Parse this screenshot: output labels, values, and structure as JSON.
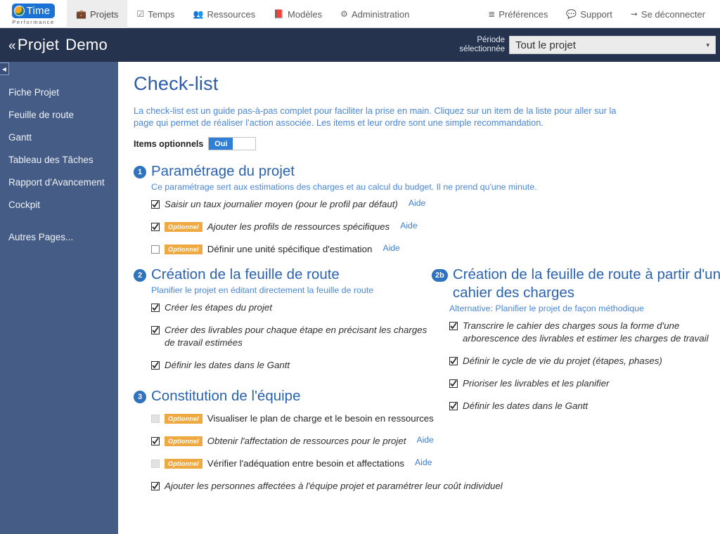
{
  "topnav": {
    "logo": {
      "word": "Time",
      "sub": "Performance",
      "icon": "globe-icon"
    },
    "items": [
      {
        "label": "Projets",
        "icon": "briefcase-icon",
        "active": true
      },
      {
        "label": "Temps",
        "icon": "check-square-icon",
        "active": false
      },
      {
        "label": "Ressources",
        "icon": "users-icon",
        "active": false
      },
      {
        "label": "Modèles",
        "icon": "book-icon",
        "active": false
      },
      {
        "label": "Administration",
        "icon": "gears-icon",
        "active": false
      }
    ],
    "right_items": [
      {
        "label": "Préférences",
        "icon": "sliders-icon"
      },
      {
        "label": "Support",
        "icon": "comment-icon"
      },
      {
        "label": "Se déconnecter",
        "icon": "logout-icon"
      }
    ]
  },
  "project_header": {
    "back_chevron": "«",
    "prefix": "Projet",
    "project_name": "Demo",
    "period_label_line1": "Période",
    "period_label_line2": "sélectionnée",
    "period_value": "Tout le projet",
    "period_options": [
      "Tout le projet"
    ],
    "caret": "▾"
  },
  "sidebar": {
    "collapse_icon": "◀",
    "items": [
      {
        "label": "Fiche Projet"
      },
      {
        "label": "Feuille de route"
      },
      {
        "label": "Gantt"
      },
      {
        "label": "Tableau des Tâches"
      },
      {
        "label": "Rapport d'Avancement"
      },
      {
        "label": "Cockpit"
      }
    ],
    "footer_item": {
      "label": "Autres Pages..."
    }
  },
  "main": {
    "title": "Check-list",
    "description": "La check-list est un guide pas-à-pas complet pour faciliter la prise en main. Cliquez sur un item de la liste pour aller sur la page qui permet de réaliser l'action associée. Les items et leur ordre sont une simple recommandation.",
    "optional_label": "Items optionnels",
    "optional_toggle_value": "Oui",
    "help_link_label": "Aide",
    "optional_tag_label": "Optionnel",
    "sections": {
      "s1": {
        "badge": "1",
        "title": "Paramétrage du projet",
        "subtitle": "Ce paramétrage sert aux estimations des charges et au calcul du budget. Il ne prend qu'une minute.",
        "items": [
          {
            "state": "checked",
            "optional": false,
            "text": "Saisir un taux journalier moyen (pour le profil par défaut)",
            "help": true
          },
          {
            "state": "checked",
            "optional": true,
            "text": "Ajouter les profils de ressources spécifiques",
            "help": true
          },
          {
            "state": "unchecked",
            "optional": true,
            "text": "Définir une unité spécifique d'estimation",
            "help": true
          }
        ]
      },
      "s2": {
        "badge": "2",
        "title": "Création de la feuille de route",
        "subtitle": "Planifier le projet en éditant directement la feuille de route",
        "items": [
          {
            "state": "checked",
            "optional": false,
            "text": "Créer les étapes du projet",
            "help": false
          },
          {
            "state": "checked",
            "optional": false,
            "text": "Créer des livrables pour chaque étape en précisant les charges de travail estimées",
            "help": false
          },
          {
            "state": "checked",
            "optional": false,
            "text": "Définir les dates dans le Gantt",
            "help": false
          }
        ]
      },
      "s2b": {
        "badge": "2b",
        "title": "Création de la feuille de route à partir d'un cahier des charges",
        "subtitle": "Alternative: Planifier le projet de façon méthodique",
        "items": [
          {
            "state": "checked",
            "optional": false,
            "text": "Transcrire le cahier des charges sous la forme d'une arborescence des livrables et estimer les charges de travail",
            "help": false
          },
          {
            "state": "checked",
            "optional": false,
            "text": "Définir le cycle de vie du projet (étapes, phases)",
            "help": false
          },
          {
            "state": "checked",
            "optional": false,
            "text": "Prioriser les livrables et les planifier",
            "help": false
          },
          {
            "state": "checked",
            "optional": false,
            "text": "Définir les dates dans le Gantt",
            "help": false
          }
        ]
      },
      "s3": {
        "badge": "3",
        "title": "Constitution de l'équipe",
        "subtitle": "",
        "items": [
          {
            "state": "disabled",
            "optional": true,
            "text": "Visualiser le plan de charge et le besoin en ressources",
            "help": false
          },
          {
            "state": "checked",
            "optional": true,
            "text": "Obtenir l'affectation de ressources pour le projet",
            "help": true
          },
          {
            "state": "disabled",
            "optional": true,
            "text": "Vérifier l'adéquation entre besoin et affectations",
            "help": true
          },
          {
            "state": "checked",
            "optional": false,
            "text": "Ajouter les personnes affectées à l'équipe projet et paramétrer leur coût individuel",
            "help": false
          }
        ]
      }
    }
  },
  "colors": {
    "header_bar": "#25334f",
    "sidebar": "#455c87",
    "accent_blue": "#2b63b0",
    "link_blue": "#4a86d6",
    "tag_orange": "#f0a940",
    "toggle_on": "#2f7ed8"
  }
}
